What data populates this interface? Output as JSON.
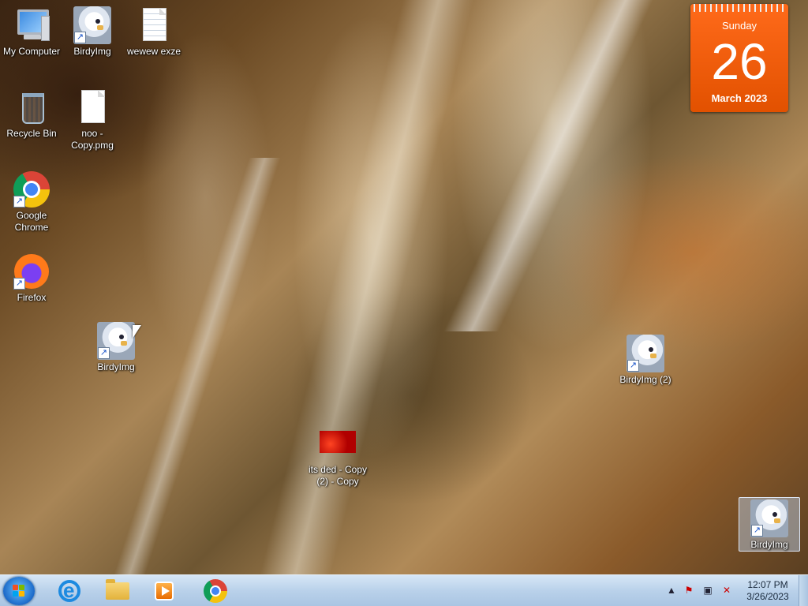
{
  "desktop": {
    "icons": [
      {
        "label": "My Computer"
      },
      {
        "label": "BirdyImg"
      },
      {
        "label": "wewew exze"
      },
      {
        "label": "Recycle Bin"
      },
      {
        "label": "noo - Copy.pmg"
      },
      {
        "label": "Google Chrome"
      },
      {
        "label": "Firefox"
      },
      {
        "label": "BirdyImg"
      },
      {
        "label": "BirdyImg (2)"
      },
      {
        "label": "its ded - Copy (2) - Copy"
      },
      {
        "label": "BirdyImg"
      }
    ]
  },
  "calendar": {
    "day_name": "Sunday",
    "day_number": "26",
    "month_year": "March 2023"
  },
  "taskbar": {
    "apps": [
      {
        "icon": "internet-explorer-icon"
      },
      {
        "icon": "file-explorer-icon"
      },
      {
        "icon": "media-player-icon"
      },
      {
        "icon": "chrome-icon"
      }
    ],
    "tray": {
      "icons": [
        "show-hidden-icons-chevron",
        "action-center-flag-icon",
        "network-icon",
        "volume-muted-icon"
      ],
      "time": "12:07 PM",
      "date": "3/26/2023"
    }
  },
  "colors": {
    "calendar_orange": "#e25100",
    "taskbar_blue": "#b9d1ea"
  }
}
